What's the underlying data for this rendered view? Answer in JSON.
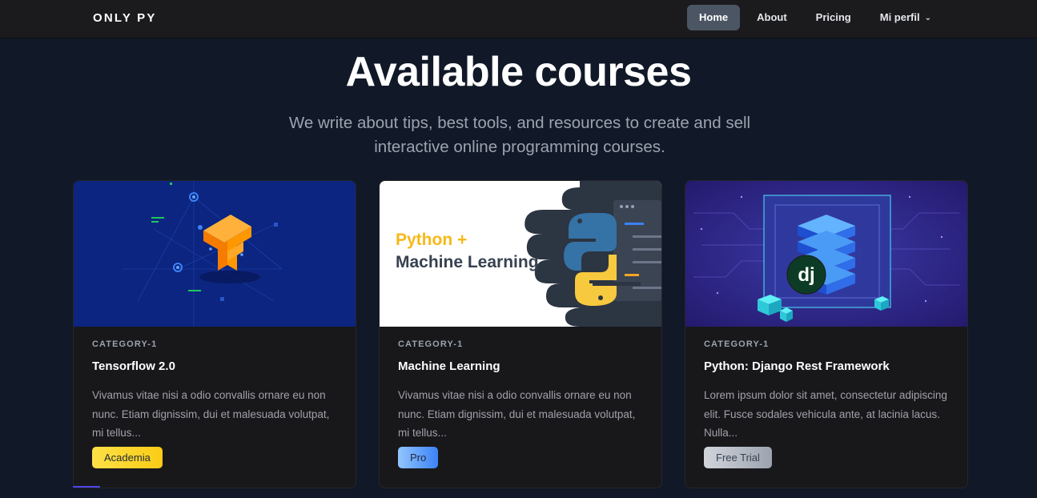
{
  "nav": {
    "brand": "ONLY PY",
    "links": [
      {
        "label": "Home",
        "active": true
      },
      {
        "label": "About",
        "active": false
      },
      {
        "label": "Pricing",
        "active": false
      },
      {
        "label": "Mi perfil",
        "active": false
      }
    ],
    "profile_icon": "chevron-down-icon"
  },
  "hero": {
    "title": "Available courses",
    "subtitle": "We write about tips, best tools, and resources to create and sell interactive online programming courses."
  },
  "courses": [
    {
      "category": "CATEGORY-1",
      "title": "Tensorflow 2.0",
      "description": "Vivamus vitae nisi a odio convallis ornare eu non nunc. Etiam dignissim, dui et malesuada volutpat, mi tellus...",
      "badge": "Academia",
      "image_icon": "tensorflow-logo"
    },
    {
      "category": "CATEGORY-1",
      "title": "Machine Learning",
      "description": "Vivamus vitae nisi a odio convallis ornare eu non nunc. Etiam dignissim, dui et malesuada volutpat, mi tellus...",
      "badge": "Pro",
      "image_icon": "python-logo",
      "image_text": [
        "Python +",
        "Machine Learning"
      ]
    },
    {
      "category": "CATEGORY-1",
      "title": "Python: Django Rest Framework",
      "description": "Lorem ipsum dolor sit amet, consectetur adipiscing elit. Fusce sodales vehicula ante, at lacinia lacus. Nulla...",
      "badge": "Free Trial",
      "image_icon": "django-server-stack",
      "image_logo_text": "dj"
    }
  ],
  "colors": {
    "page_bg": "#111827",
    "navbar_bg": "#1b1b1d",
    "card_bg": "#18181b",
    "badge_academia": "#facc15",
    "badge_pro": "#60a5fa",
    "badge_free": "#b8bcc4"
  }
}
